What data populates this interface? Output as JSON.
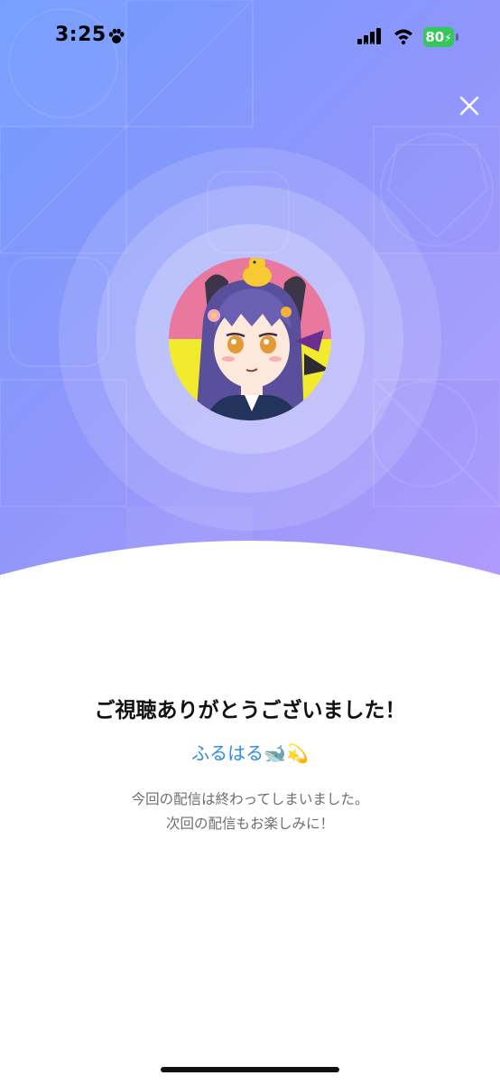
{
  "status_bar": {
    "time": "3:25",
    "battery_level": "80",
    "icons": [
      "paw-icon",
      "signal-icon",
      "wifi-icon",
      "battery-charging-icon"
    ]
  },
  "hero": {
    "close_icon": "close-icon",
    "avatar_icon": "streamer-avatar",
    "colors": {
      "gradient_start": "#6f9bff",
      "gradient_end": "#b19bfb",
      "avatar_top": "#e9789f",
      "avatar_bottom": "#f2ea2d"
    }
  },
  "content": {
    "title": "ご視聴ありがとうございました！",
    "streamer_name": "ふるはる🐋💫",
    "message_line1": "今回の配信は終わってしまいました。",
    "message_line2": "次回の配信もお楽しみに！",
    "colors": {
      "streamer_name": "#2f8de4",
      "title": "#111111",
      "message": "#6e6e6e"
    }
  }
}
